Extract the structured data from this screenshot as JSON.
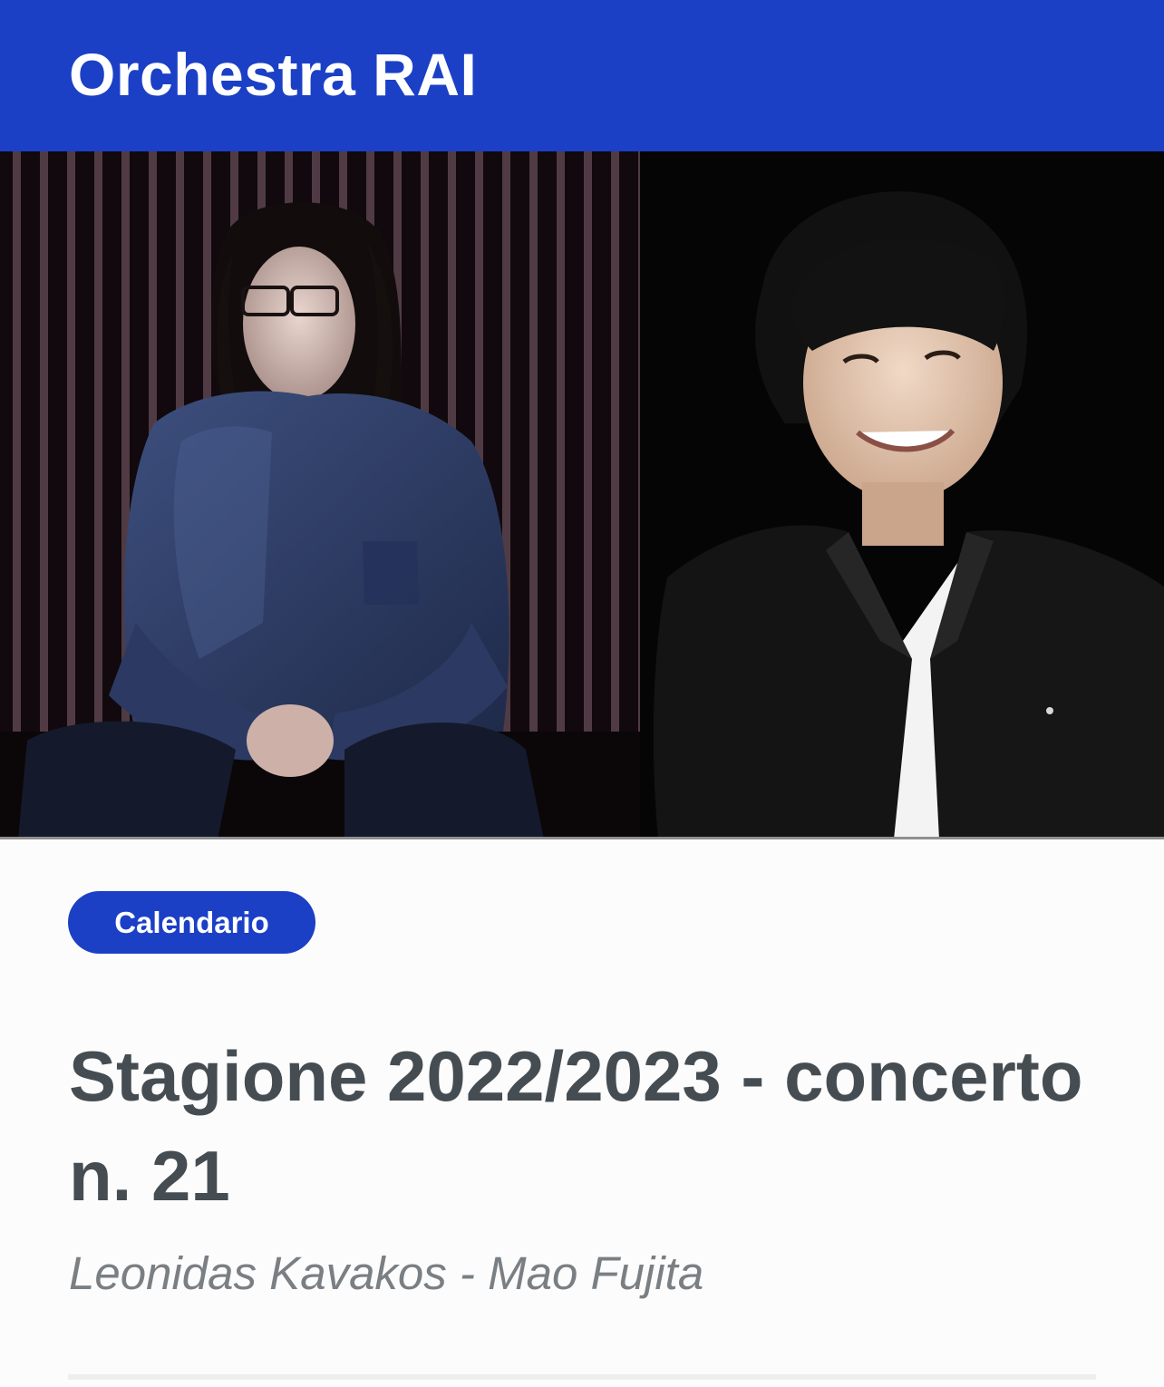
{
  "header": {
    "title": "Orchestra RAI",
    "background_color": "#1b40c6"
  },
  "hero": {
    "left_photo": "portrait-leonidas-kavakos",
    "right_photo": "portrait-mao-fujita"
  },
  "category": {
    "label": "Calendario"
  },
  "article": {
    "title": "Stagione 2022/2023 - concerto n. 21",
    "subtitle": "Leonidas Kavakos - Mao Fujita"
  },
  "colors": {
    "accent": "#1b40c6",
    "title_text": "#454d52",
    "subtitle_text": "#7a7f83"
  }
}
